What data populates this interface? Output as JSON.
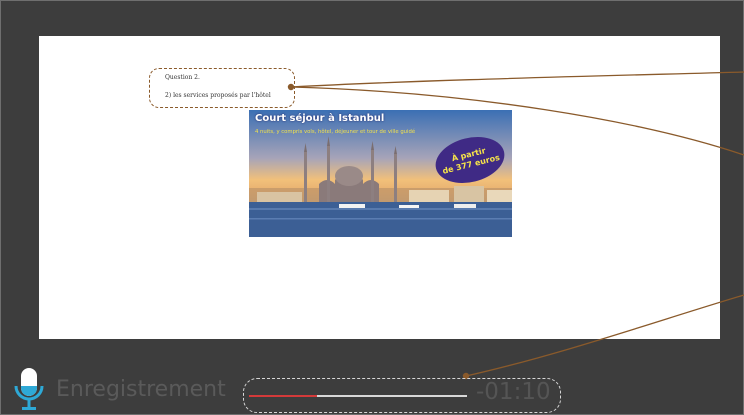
{
  "slide": {
    "question": {
      "heading": "Question 2.",
      "text": "2) les services proposés par l'hôtel"
    },
    "ad": {
      "title": "Court séjour à Istanbul",
      "subtitle": "4 nuits, y compris vols, hôtel, déjeuner et tour de ville guidé",
      "badge_line1": "À partir",
      "badge_line2": "de 377 euros"
    }
  },
  "recorder": {
    "label": "Enregistrement",
    "time": "-01:10",
    "progress_fraction": 0.31,
    "progress_color": "#d43a3a"
  },
  "colors": {
    "annotation": "#8a5a2b",
    "mic_accent": "#2ea9d6"
  },
  "icons": {
    "mic": "microphone-icon"
  }
}
